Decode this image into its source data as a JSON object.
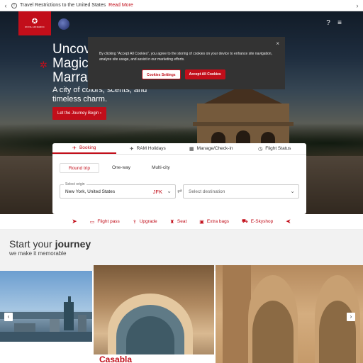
{
  "alert": {
    "text": "Travel Restrictions to the United States",
    "link": "Read More",
    "prev_icon": "chevron-left-icon",
    "next_icon": "chevron-right-icon"
  },
  "header": {
    "logo_icon": "royal-air-maroc-star-icon",
    "alliance_icon": "oneworld-icon",
    "icons": [
      "help-icon",
      "menu-icon"
    ]
  },
  "hero": {
    "title_lines": [
      "Uncov",
      "Magic",
      "Marrak"
    ],
    "subtitle": "A city of colors, scents, and timeless charm.",
    "cta": "Let the Journey Begin",
    "cta_arrow": "›"
  },
  "cookie": {
    "text": "By clicking \"Accept All Cookies\", you agree to the storing of cookies on your device to enhance site navigation, analyze site usage, and assist in our marketing efforts.",
    "settings_label": "Cookies Settings",
    "accept_label": "Accept All Cookies",
    "close": "×"
  },
  "booking": {
    "tabs": [
      {
        "label": "Booking",
        "icon": "plane-icon",
        "glyph": "✈"
      },
      {
        "label": "RAM Holidays",
        "icon": "holidays-plane-icon",
        "glyph": "✈"
      },
      {
        "label": "Manage/Check-in",
        "icon": "calendar-icon",
        "glyph": "▦"
      },
      {
        "label": "Flight Status",
        "icon": "clock-icon",
        "glyph": "◷"
      }
    ],
    "trip_types": [
      "Round trip",
      "One-way",
      "Multi-city"
    ],
    "origin": {
      "label": "Select origin",
      "value": "New York, United States",
      "code": "JFK"
    },
    "destination": {
      "placeholder": "Select destination"
    }
  },
  "quick_links": [
    {
      "label": "Flight pass",
      "icon": "flight-pass-icon",
      "glyph": "▭"
    },
    {
      "label": "Upgrade",
      "icon": "upgrade-icon",
      "glyph": "⇪"
    },
    {
      "label": "Seat",
      "icon": "seat-icon",
      "glyph": "♜"
    },
    {
      "label": "Extra bags",
      "icon": "bag-icon",
      "glyph": "▣"
    },
    {
      "label": "E-Skyshop",
      "icon": "cart-icon",
      "glyph": "⛟"
    }
  ],
  "journey": {
    "title_plain": "Start your ",
    "title_bold": "journey",
    "subtitle": "we make it memorable"
  },
  "gallery": {
    "second_caption": "Casabla"
  },
  "colors": {
    "brand_red": "#c20e1a",
    "dialog_bg": "#333333"
  }
}
